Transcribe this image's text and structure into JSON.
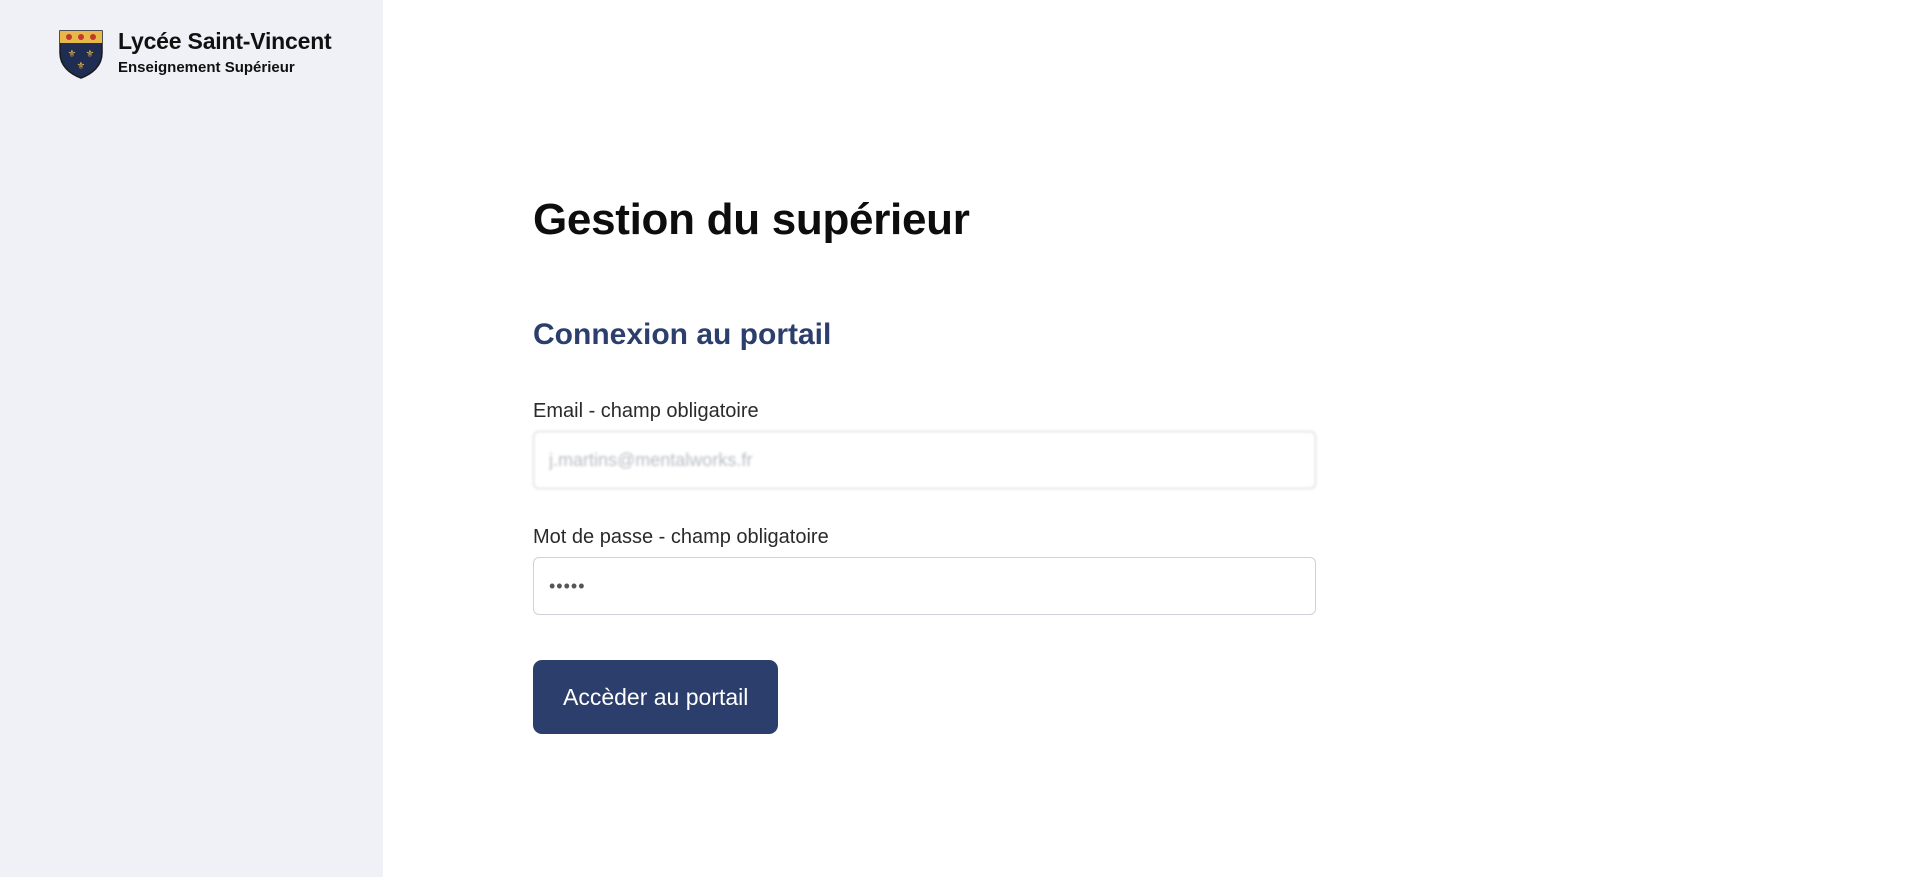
{
  "brand": {
    "name": "Lycée Saint-Vincent",
    "subtitle": "Enseignement Supérieur",
    "crest_icon": "shield-crest-icon"
  },
  "main": {
    "page_title": "Gestion du supérieur",
    "section_title": "Connexion au portail",
    "email": {
      "label": "Email - champ obligatoire",
      "value": "j.martins@mentalworks.fr"
    },
    "password": {
      "label": "Mot de passe - champ obligatoire",
      "value": "•••••"
    },
    "submit_label": "Accèder au portail"
  },
  "colors": {
    "sidebar_bg": "#f0f1f6",
    "accent": "#2c3e6b",
    "crest_gold": "#e8b84a",
    "crest_navy": "#1f2d52",
    "crest_red": "#c0392b"
  }
}
